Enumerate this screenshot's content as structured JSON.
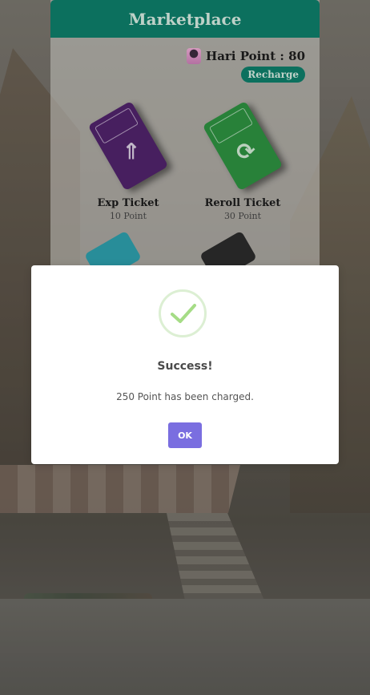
{
  "marketplace": {
    "title": "Marketplace",
    "points_label": "Hari Point : 80",
    "recharge_label": "Recharge",
    "items": [
      {
        "name": "Exp Ticket",
        "price": "10 Point",
        "color": "#4e2268",
        "icon": "double-chevron-up-icon"
      },
      {
        "name": "Reroll Ticket",
        "price": "30 Point",
        "color": "#2c8c3e",
        "icon": "refresh-icon"
      }
    ]
  },
  "dialog": {
    "title": "Success!",
    "message": "250 Point has been charged.",
    "ok_label": "OK",
    "accent": "#7a6ee0",
    "icon": "success-check-icon"
  }
}
